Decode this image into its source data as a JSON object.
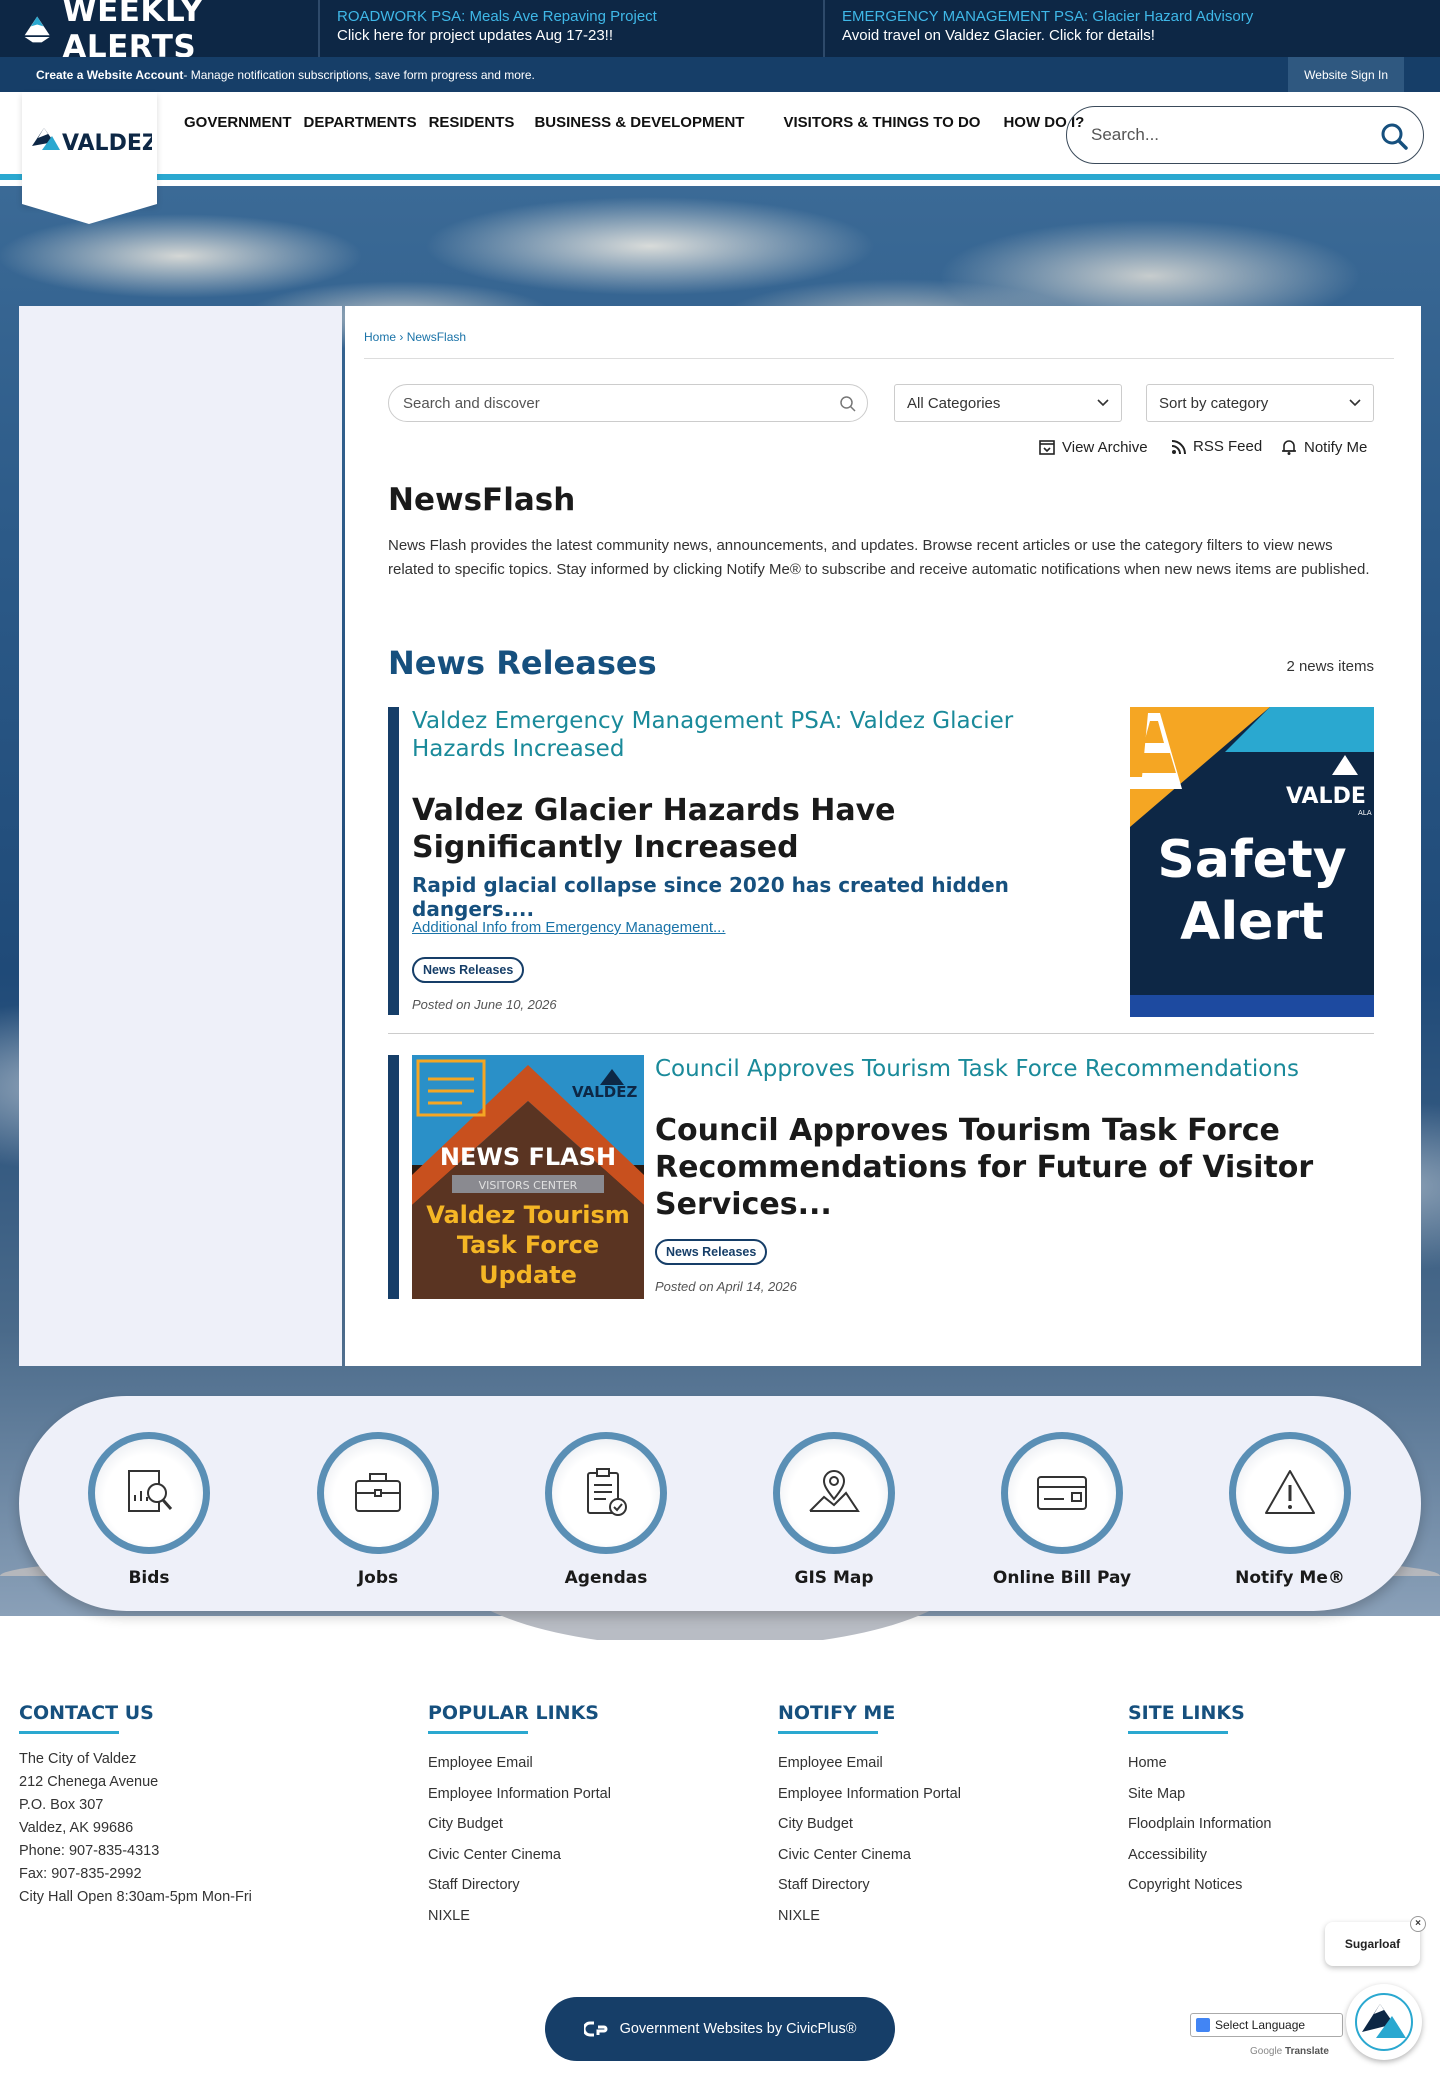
{
  "alerts": {
    "brand": "WEEKLY ALERTS",
    "items": [
      {
        "title": "ROADWORK PSA: Meals Ave Repaving Project",
        "desc": "Click here for project updates Aug 17-23!!"
      },
      {
        "title": "EMERGENCY MANAGEMENT PSA: Glacier Hazard Advisory",
        "desc": "Avoid travel on Valdez Glacier. Click for details!"
      }
    ]
  },
  "account_bar": {
    "link": "Create a Website Account",
    "text": " - Manage notification subscriptions, save form progress and more.",
    "signin": "Website Sign In"
  },
  "header": {
    "logo_text": "VALDEZ",
    "nav": [
      "GOVERNMENT",
      "DEPARTMENTS",
      "RESIDENTS",
      "BUSINESS & DEVELOPMENT",
      "VISITORS & THINGS TO DO",
      "HOW DO I?"
    ],
    "search_placeholder": "Search..."
  },
  "breadcrumb": {
    "home": "Home",
    "sep": " › ",
    "current": "NewsFlash"
  },
  "filters": {
    "search_placeholder": "Search and discover",
    "category": "All Categories",
    "sort": "Sort by category"
  },
  "tools": {
    "archive": "View Archive",
    "rss": "RSS Feed",
    "notify": "Notify Me"
  },
  "page": {
    "title": "NewsFlash",
    "description": "News Flash provides the latest community news, announcements, and updates. Browse recent articles or use the category filters to view news related to specific topics. Stay informed by clicking Notify Me® to subscribe and receive automatic notifications when new news items are published."
  },
  "section": {
    "title": "News Releases",
    "count": "2 news items"
  },
  "news": [
    {
      "link": "Valdez Emergency Management PSA: Valdez Glacier Hazards Increased",
      "headline": "Valdez Glacier Hazards Have Significantly Increased",
      "sub": "Rapid glacial collapse since 2020 has created hidden dangers....",
      "more": "Additional Info from Emergency Management...",
      "tag": "News Releases",
      "posted": "Posted on June 10, 2026",
      "thumb": {
        "line1": "Safety",
        "line2": "Alert",
        "logo": "VALDE",
        "logo_sub": "ALA"
      }
    },
    {
      "link": "Council Approves Tourism Task Force Recommendations",
      "headline": "Council Approves Tourism Task Force Recommendations for Future of Visitor Services...",
      "tag": "News Releases",
      "posted": "Posted on April 14, 2026",
      "thumb": {
        "banner": "NEWS FLASH",
        "sign": "VISITORS CENTER",
        "line1": "Valdez Tourism",
        "line2": "Task Force",
        "line3": "Update",
        "logo": "VALDEZ"
      }
    }
  ],
  "quicklinks": [
    {
      "label": "Bids",
      "icon": "bids-icon"
    },
    {
      "label": "Jobs",
      "icon": "briefcase-icon"
    },
    {
      "label": "Agendas",
      "icon": "clipboard-icon"
    },
    {
      "label": "GIS Map",
      "icon": "map-pin-icon"
    },
    {
      "label": "Online Bill Pay",
      "icon": "card-icon"
    },
    {
      "label": "Notify Me®",
      "icon": "warning-icon"
    }
  ],
  "footer": {
    "contact": {
      "title": "CONTACT US",
      "lines": [
        "The City of Valdez",
        "212 Chenega Avenue",
        "P.O. Box 307",
        "Valdez, AK 99686",
        "Phone: 907-835-4313",
        "Fax: 907-835-2992",
        "City Hall Open 8:30am-5pm Mon-Fri"
      ]
    },
    "popular": {
      "title": "POPULAR LINKS",
      "links": [
        "Employee Email",
        "Employee Information Portal",
        "City Budget",
        "Civic Center Cinema",
        "Staff Directory",
        "NIXLE"
      ]
    },
    "notify": {
      "title": "NOTIFY ME",
      "links": [
        "Employee Email",
        "Employee Information Portal",
        "City Budget",
        "Civic Center Cinema",
        "Staff Directory",
        "NIXLE"
      ]
    },
    "site": {
      "title": "SITE LINKS",
      "links": [
        "Home",
        "Site Map",
        "Floodplain Information",
        "Accessibility",
        "Copyright Notices"
      ]
    },
    "civic": "Government Websites by CivicPlus®",
    "sugarloaf": "Sugarloaf",
    "close": "×",
    "language": "Select Language",
    "powered_by": "Google",
    "translate": "Translate"
  },
  "colors": {
    "navy": "#0d2745",
    "accent": "#2aa8d0",
    "link_teal": "#1a8a9a",
    "heading_blue": "#16507e"
  }
}
